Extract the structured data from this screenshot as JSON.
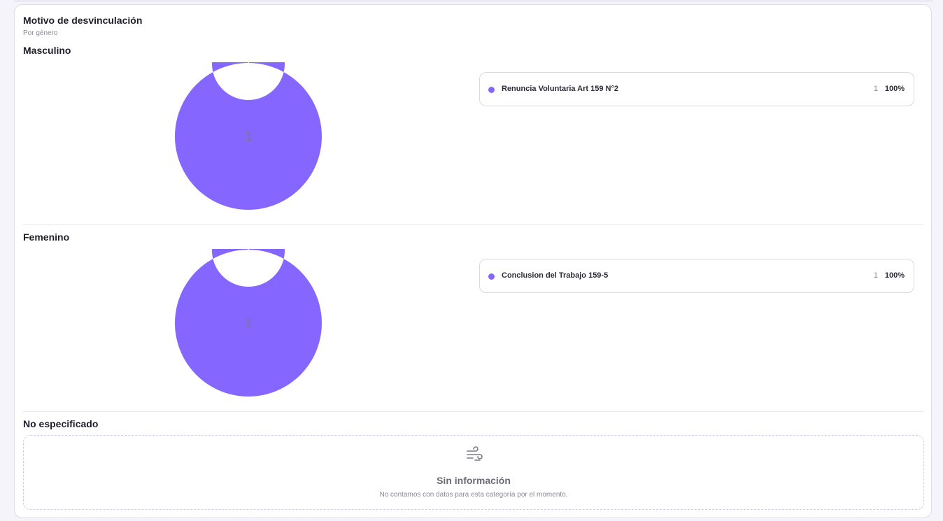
{
  "card": {
    "title": "Motivo de desvinculación",
    "subtitle": "Por género"
  },
  "colors": {
    "accent": "#8566ff",
    "donut_separator": "#ffffff"
  },
  "chart_data": [
    {
      "type": "pie",
      "title": "Masculino",
      "center_label": "1",
      "categories": [
        "Renuncia Voluntaria Art 159 N°2"
      ],
      "values": [
        1
      ],
      "percentages": [
        "100%"
      ],
      "colors": [
        "#8566ff"
      ]
    },
    {
      "type": "pie",
      "title": "Femenino",
      "center_label": "1",
      "categories": [
        "Conclusion del Trabajo 159-5"
      ],
      "values": [
        1
      ],
      "percentages": [
        "100%"
      ],
      "colors": [
        "#8566ff"
      ]
    }
  ],
  "empty_section": {
    "title": "No especificado",
    "icon": "wind-icon",
    "message_title": "Sin información",
    "message_text": "No contamos con datos para esta categoría por el momento."
  }
}
